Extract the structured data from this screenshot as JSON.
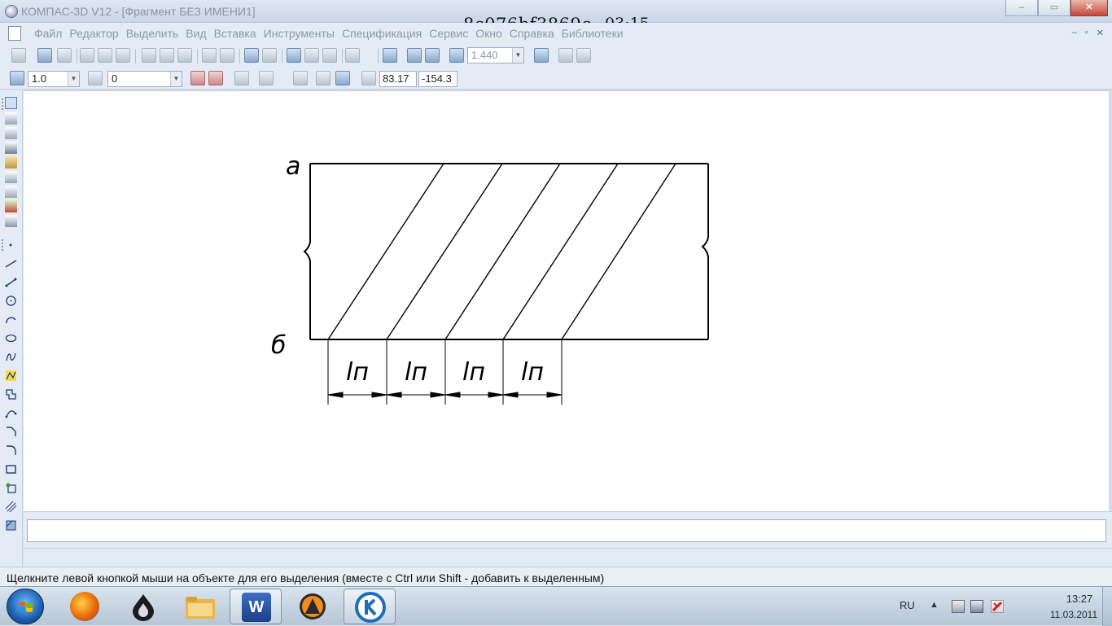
{
  "window": {
    "title": "КОМПАС-3D V12 - [Фрагмент БЕЗ ИМЕНИ1]",
    "overlay_id": "8c076bf3869c",
    "overlay_time": "03:15",
    "buttons": {
      "minimize": "–",
      "maximize": "▭",
      "close": "✕"
    }
  },
  "menu": {
    "items": [
      "Файл",
      "Редактор",
      "Выделить",
      "Вид",
      "Вставка",
      "Инструменты",
      "Спецификация",
      "Сервис",
      "Окно",
      "Справка",
      "Библиотеки"
    ],
    "mdi_buttons": [
      "–",
      "▫",
      "✕"
    ]
  },
  "toolbar1": {
    "zoom_value": "1.440"
  },
  "toolbar2": {
    "step_value": "1.0",
    "layer_value": "0",
    "coord_x": "83.17",
    "coord_y": "-154.3"
  },
  "drawing": {
    "label_top": "а",
    "label_bottom": "б",
    "dim_labels": [
      "lп",
      "lп",
      "lп",
      "lп"
    ]
  },
  "propbar": {
    "value": ""
  },
  "status": {
    "text": "Щелкните левой кнопкой мыши на объекте для его выделения (вместе с Ctrl или Shift - добавить к выделенным)"
  },
  "taskbar": {
    "apps": [
      "start-orb",
      "firefox",
      "inkscape-like",
      "explorer",
      "word",
      "avast",
      "kompas"
    ],
    "lang": "RU",
    "time": "13:27",
    "date": "11.03.2011"
  }
}
